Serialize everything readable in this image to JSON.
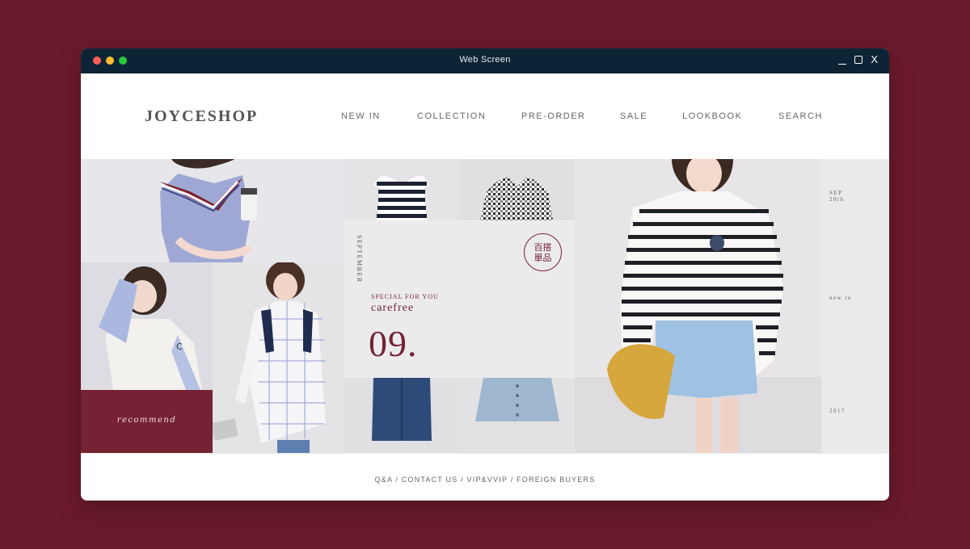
{
  "window": {
    "title": "Web Screen",
    "controls": [
      "_",
      "□",
      "X"
    ]
  },
  "header": {
    "logo": "JOYCESHOP",
    "nav": [
      {
        "label": "NEW IN"
      },
      {
        "label": "COLLECTION"
      },
      {
        "label": "PRE-ORDER"
      },
      {
        "label": "SALE"
      },
      {
        "label": "LOOKBOOK"
      },
      {
        "label": "SEARCH"
      }
    ]
  },
  "feature": {
    "month": "SEPTEMBER",
    "stamp_line1": "百搭",
    "stamp_line2": "單品",
    "special": "SPECIAL FOR YOU",
    "tagline": "carefree",
    "number": "09."
  },
  "recommend": "recommend",
  "sidebar": {
    "date_month": "SEP",
    "date_day": "28th",
    "label": "new in",
    "year": "2017"
  },
  "footer": {
    "links": "Q&A / CONTACT US / VIP&VVIP / FOREIGN BUYERS"
  },
  "colors": {
    "background": "#6b1a2b",
    "accent": "#762234",
    "titlebar": "#0d2436"
  },
  "icons": [
    "close-dot-icon",
    "minimize-dot-icon",
    "zoom-dot-icon",
    "minimize-icon",
    "maximize-icon",
    "close-icon"
  ]
}
